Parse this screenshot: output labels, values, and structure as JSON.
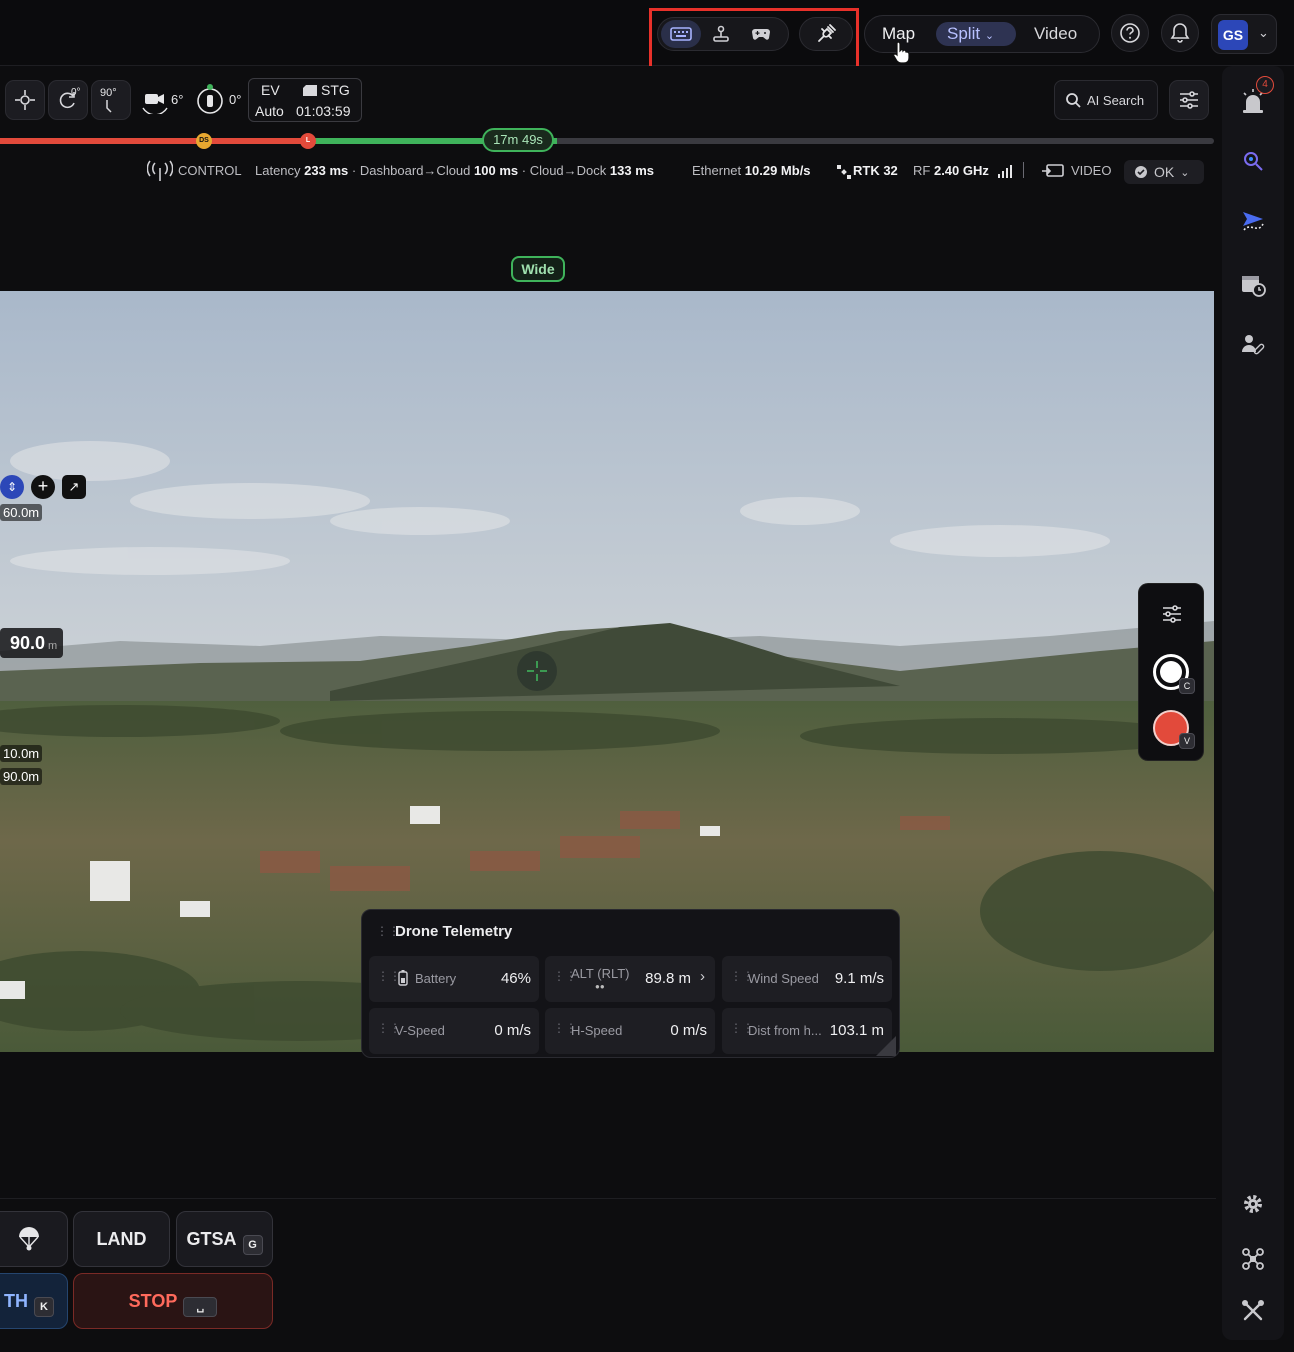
{
  "topbar": {
    "view_tabs": {
      "map": "Map",
      "split": "Split",
      "video": "Video"
    },
    "avatar_initials": "GS"
  },
  "toolbar": {
    "gimbal_pitch": "0°",
    "gimbal_tilt": "90°",
    "camera_angle": "6°",
    "heading": "0°",
    "ev_label": "EV",
    "ev_value": "Auto",
    "storage_label": "STG",
    "storage_time": "01:03:59",
    "search_label": "AI Search"
  },
  "timeline": {
    "ds_marker": "DS",
    "l_marker": "L",
    "remaining": "17m 49s"
  },
  "status": {
    "control_label": "CONTROL",
    "latency_label": "Latency",
    "latency_value": "233 ms",
    "dash_cloud_label": "· Dashboard→Cloud",
    "dash_cloud_value": "100 ms",
    "cloud_dock_label": "· Cloud→Dock",
    "cloud_dock_value": "133 ms",
    "ethernet_label": "Ethernet",
    "ethernet_value": "10.29 Mb/s",
    "rtk_value": "RTK 32",
    "rf_label": "RF",
    "rf_value": "2.40 GHz",
    "video_label": "VIDEO",
    "ok_label": "OK"
  },
  "camera": {
    "lens_tag": "Wide",
    "height_top": "60.0m",
    "height_main": "90.0",
    "height_unit": "m",
    "height_mid": "10.0m",
    "height_low": "90.0m",
    "photo_key": "C",
    "video_key": "V"
  },
  "sidebar": {
    "alert_badge": "4"
  },
  "telemetry": {
    "title": "Drone Telemetry",
    "cells": [
      {
        "label": "Battery",
        "value": "46%"
      },
      {
        "label": "ALT (RLT)",
        "value": "89.8 m"
      },
      {
        "label": "Wind Speed",
        "value": "9.1 m/s"
      },
      {
        "label": "V-Speed",
        "value": "0 m/s"
      },
      {
        "label": "H-Speed",
        "value": "0 m/s"
      },
      {
        "label": "Dist from h...",
        "value": "103.1 m"
      }
    ]
  },
  "actions": {
    "land": "LAND",
    "gtsa": "GTSA",
    "gtsa_key": "G",
    "rth": "TH",
    "rth_key": "K",
    "stop": "STOP"
  }
}
